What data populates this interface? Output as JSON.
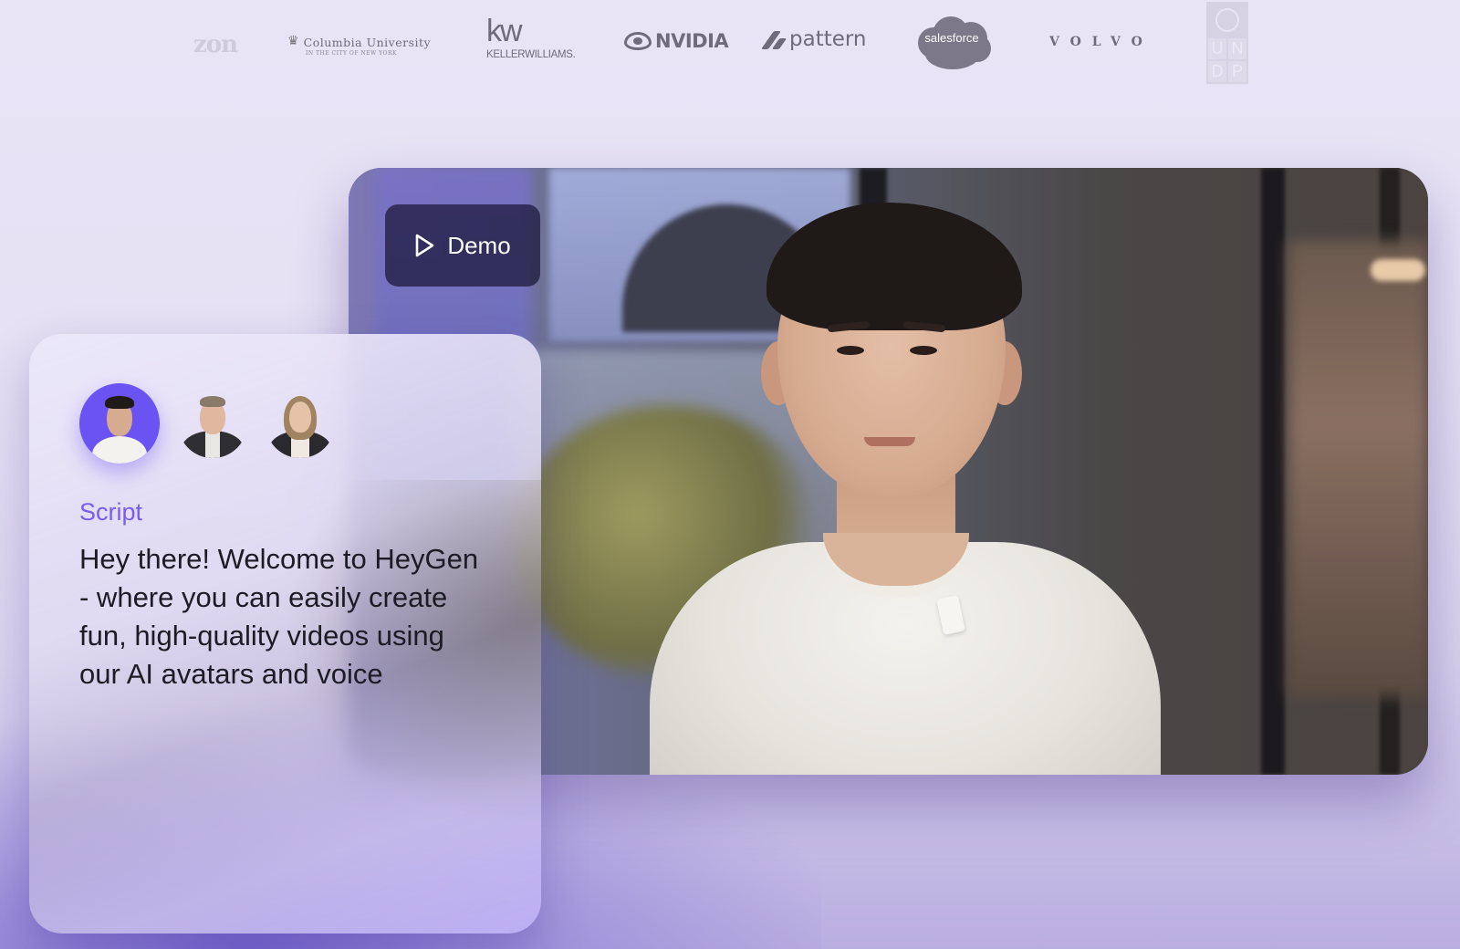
{
  "logos": [
    {
      "name": "amazon",
      "text": "zon"
    },
    {
      "name": "columbia",
      "text": "Columbia University",
      "sub": "IN THE CITY OF NEW YORK"
    },
    {
      "name": "kw",
      "text": "kw",
      "sub": "KELLERWILLIAMS."
    },
    {
      "name": "nvidia",
      "text": "NVIDIA"
    },
    {
      "name": "pattern",
      "text": "pattern"
    },
    {
      "name": "salesforce",
      "text": "salesforce"
    },
    {
      "name": "volvo",
      "text": "VOLVO"
    },
    {
      "name": "undp",
      "cells": [
        "U",
        "N",
        "D",
        "P"
      ]
    }
  ],
  "demo": {
    "label": "Demo",
    "icon": "play-icon"
  },
  "script_card": {
    "label": "Script",
    "text": "Hey there! Welcome to HeyGen - where you can easily create fun, high-quality videos using our AI avatars and voice",
    "avatars": [
      "avatar-young-man",
      "avatar-man-suit",
      "avatar-woman-blazer"
    ],
    "selected_avatar": "avatar-young-man"
  },
  "colors": {
    "accent": "#7a5cf0",
    "selected_avatar_bg": "#6b52f2",
    "background": "#e8e4f6"
  }
}
